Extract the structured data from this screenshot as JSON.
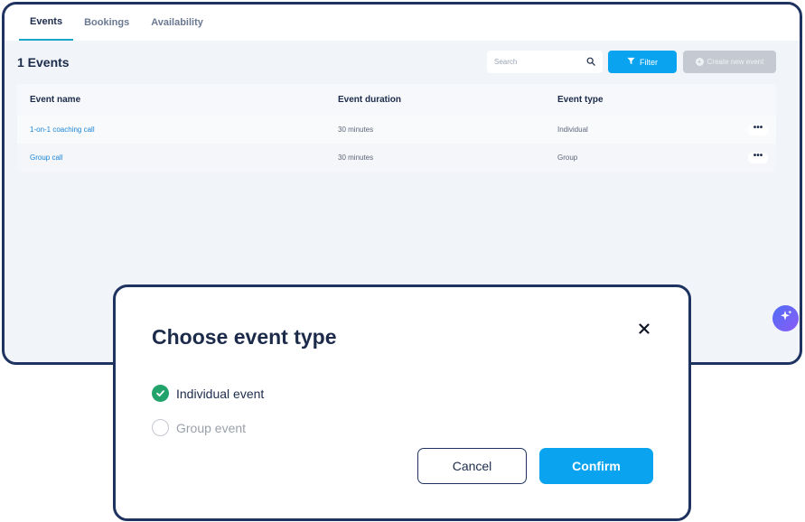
{
  "tabs": [
    {
      "label": "Events",
      "active": true
    },
    {
      "label": "Bookings",
      "active": false
    },
    {
      "label": "Availability",
      "active": false
    }
  ],
  "toolbar": {
    "events_count": "1 Events",
    "search_placeholder": "Search",
    "search_icon": "search-icon",
    "filter_label": "Filter",
    "filter_icon": "filter-icon",
    "create_label": "Create new event",
    "create_icon": "plus-circle-icon"
  },
  "table": {
    "headers": [
      "Event name",
      "Event duration",
      "Event type"
    ],
    "rows": [
      {
        "name": "1-on-1 coaching call",
        "duration": "30 minutes",
        "type": "Individual",
        "menu": "•••"
      },
      {
        "name": "Group call",
        "duration": "30 minutes",
        "type": "Group",
        "menu": "•••"
      }
    ]
  },
  "assistant": {
    "icon": "sparkle-icon"
  },
  "modal": {
    "title": "Choose event type",
    "close_icon": "close-icon",
    "options": [
      {
        "label": "Individual event",
        "selected": true
      },
      {
        "label": "Group event",
        "selected": false
      }
    ],
    "cancel_label": "Cancel",
    "confirm_label": "Confirm"
  },
  "colors": {
    "accent": "#0aa3f0",
    "border_dark": "#1f3360",
    "success": "#22a36b",
    "link": "#1a85d8",
    "tab_underline": "#1aa5c9"
  }
}
